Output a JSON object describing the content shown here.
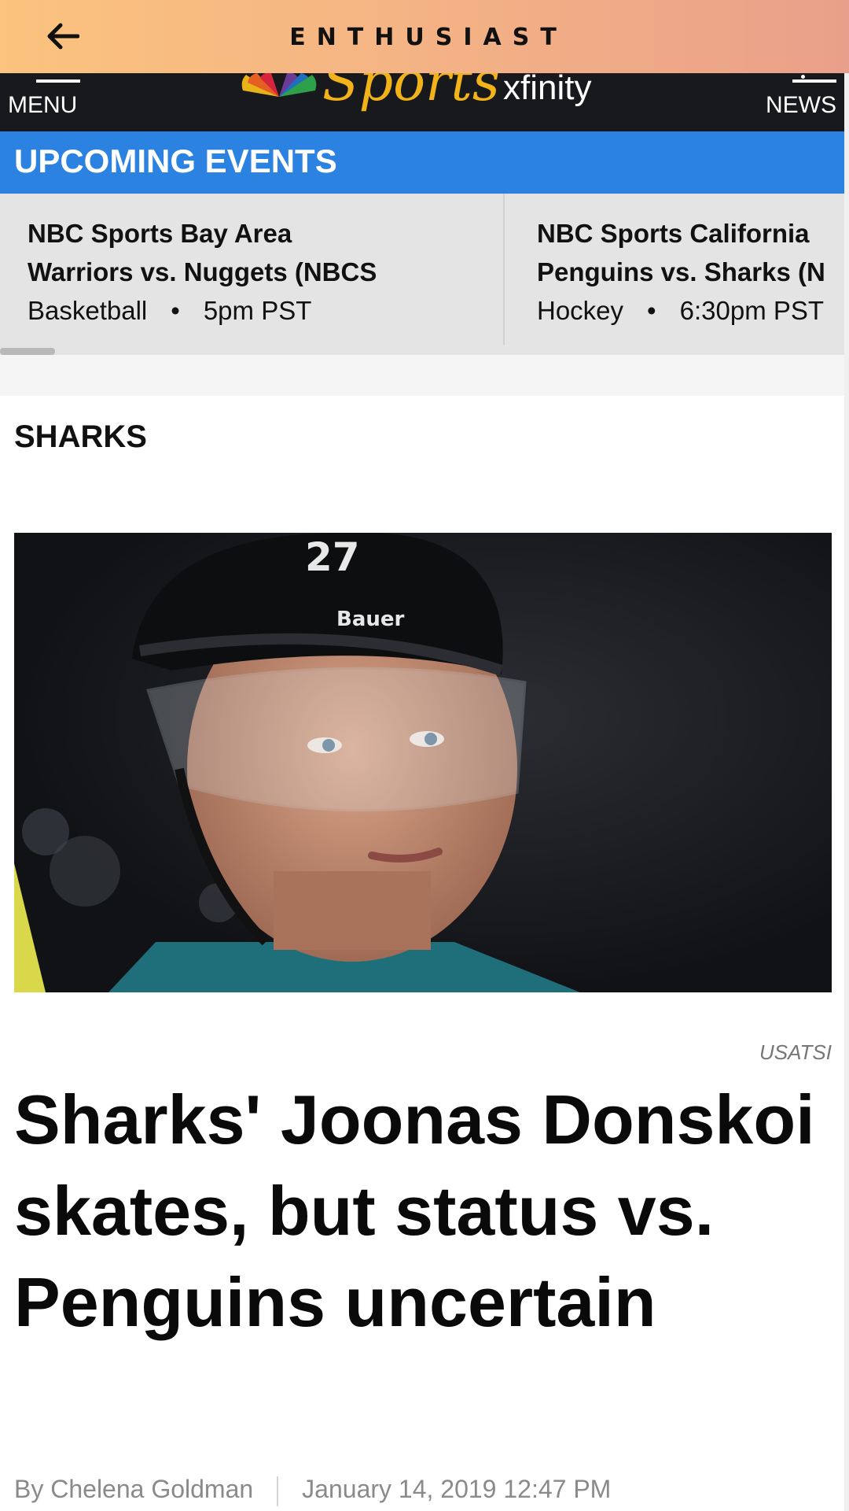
{
  "app_bar": {
    "title": "ENTHUSIAST",
    "back_icon": "arrow-left-icon"
  },
  "site_header": {
    "menu_label": "MENU",
    "news_label": "NEWS",
    "logo": {
      "sports": "Sports",
      "xfinity": "xfinity"
    }
  },
  "upcoming": {
    "title": "UPCOMING EVENTS",
    "events": [
      {
        "network": "NBC Sports Bay Area",
        "matchup": "Warriors vs. Nuggets (NBCS",
        "sport": "Basketball",
        "time": "5pm PST"
      },
      {
        "network": "NBC Sports California",
        "matchup": "Penguins vs. Sharks (N",
        "sport": "Hockey",
        "time": "6:30pm PST"
      }
    ],
    "separator": "•"
  },
  "article": {
    "section": "SHARKS",
    "image_credit": "USATSI",
    "image_text": {
      "helmet_number": "27",
      "brand": "Bauer"
    },
    "headline": "Sharks' Joonas Donskoi skates, but status vs. Penguins uncertain",
    "author": "By Chelena Goldman",
    "date": "January 14, 2019 12:47 PM"
  },
  "colors": {
    "app_bar_start": "#fbc37e",
    "app_bar_end": "#e9a08a",
    "header_bg": "#17191c",
    "upcoming_bg": "#2c82e0",
    "events_bg": "#e4e4e4"
  }
}
